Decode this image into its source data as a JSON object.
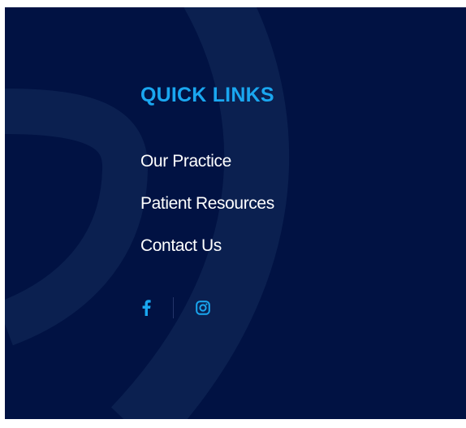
{
  "colors": {
    "panel_background": "#011243",
    "heading": "#1aa7f0",
    "link_text": "#ffffff",
    "social_icon": "#1aa7f0",
    "decor_stroke": "#0b2050"
  },
  "quick_links": {
    "heading": "QUICK LINKS",
    "items": [
      {
        "label": "Our Practice"
      },
      {
        "label": "Patient Resources"
      },
      {
        "label": "Contact Us"
      }
    ]
  },
  "social": [
    {
      "name": "facebook-icon"
    },
    {
      "name": "instagram-icon"
    }
  ]
}
